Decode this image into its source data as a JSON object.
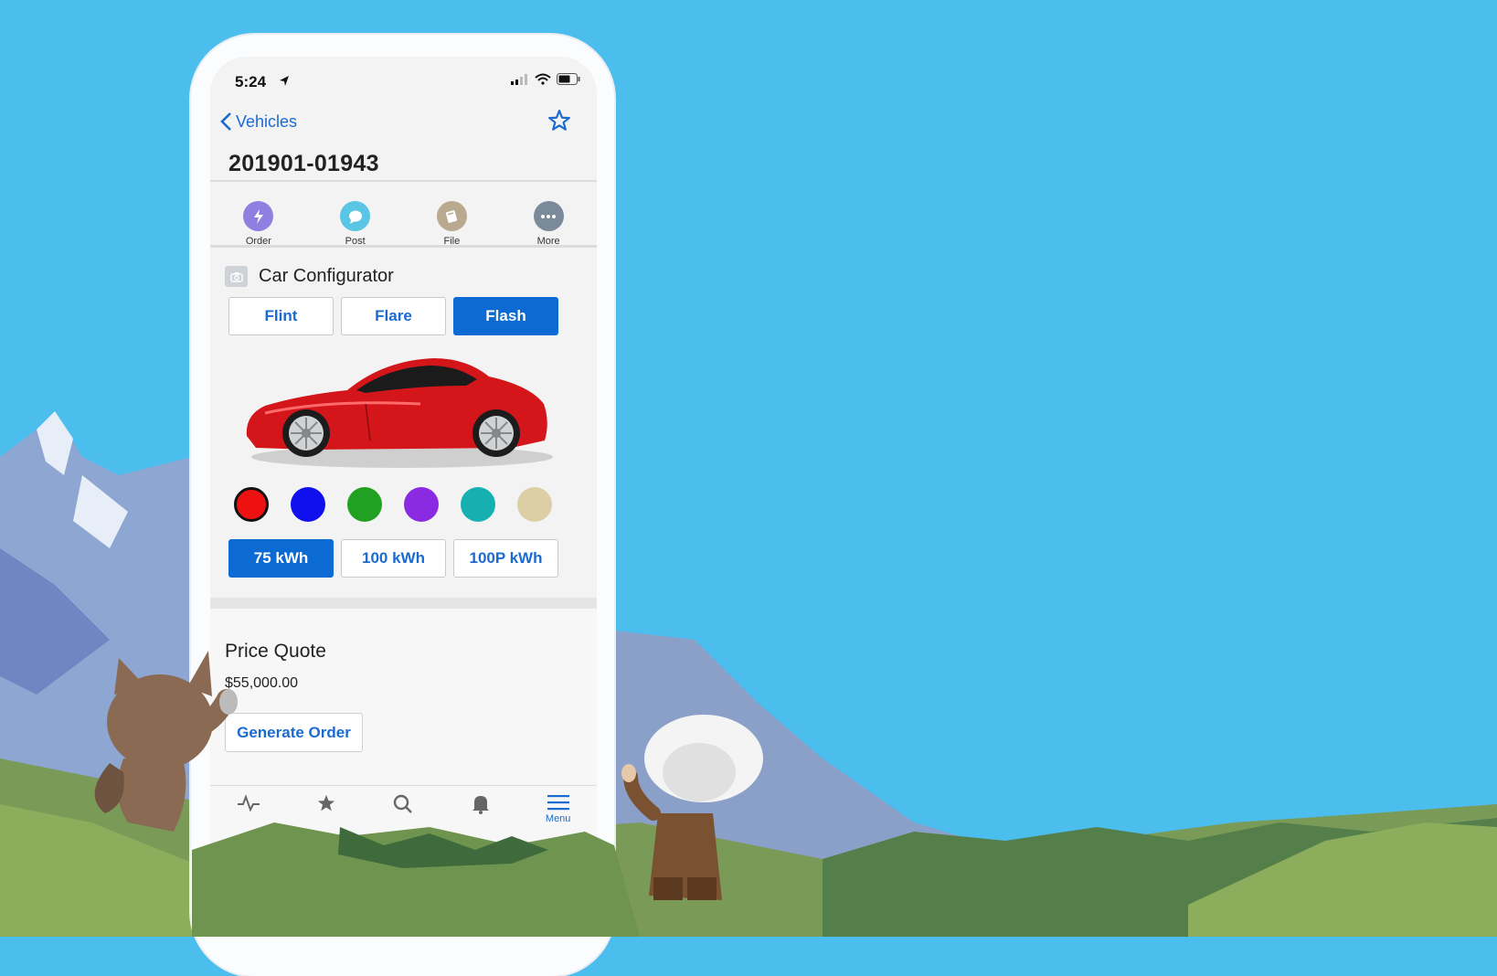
{
  "status_bar": {
    "time": "5:24"
  },
  "nav": {
    "back_label": "Vehicles"
  },
  "record": {
    "title": "201901-01943"
  },
  "actions": [
    {
      "label": "Order",
      "icon": "lightning-icon",
      "color": "#8f7fe0"
    },
    {
      "label": "Post",
      "icon": "chat-bubble-icon",
      "color": "#5bc5e5"
    },
    {
      "label": "File",
      "icon": "file-icon",
      "color": "#b9a98f"
    },
    {
      "label": "More",
      "icon": "more-dots-icon",
      "color": "#7a8a99"
    }
  ],
  "configurator": {
    "title": "Car Configurator",
    "models": [
      {
        "label": "Flint",
        "selected": false
      },
      {
        "label": "Flare",
        "selected": false
      },
      {
        "label": "Flash",
        "selected": true
      }
    ],
    "colors": [
      "#ee1111",
      "#1010ee",
      "#22a022",
      "#8a2be2",
      "#17b0b0",
      "#dccfa6"
    ],
    "selected_color": "#ee1111",
    "batteries": [
      {
        "label": "75 kWh",
        "selected": true
      },
      {
        "label": "100 kWh",
        "selected": false
      },
      {
        "label": "100P kWh",
        "selected": false
      }
    ]
  },
  "price": {
    "title": "Price Quote",
    "value": "$55,000.00",
    "button_label": "Generate Order"
  },
  "tabbar": {
    "menu_label": "Menu"
  },
  "colors": {
    "accent": "#0b6bd3",
    "sky": "#4bbeee"
  }
}
